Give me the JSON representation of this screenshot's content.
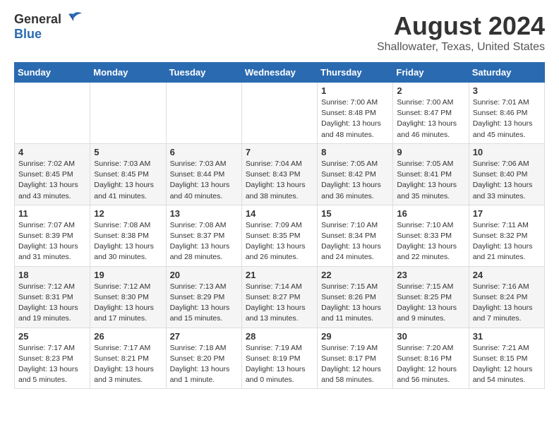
{
  "header": {
    "logo_general": "General",
    "logo_blue": "Blue",
    "title": "August 2024",
    "subtitle": "Shallowater, Texas, United States"
  },
  "calendar": {
    "days_of_week": [
      "Sunday",
      "Monday",
      "Tuesday",
      "Wednesday",
      "Thursday",
      "Friday",
      "Saturday"
    ],
    "weeks": [
      [
        {
          "day": "",
          "sunrise": "",
          "sunset": "",
          "daylight": ""
        },
        {
          "day": "",
          "sunrise": "",
          "sunset": "",
          "daylight": ""
        },
        {
          "day": "",
          "sunrise": "",
          "sunset": "",
          "daylight": ""
        },
        {
          "day": "",
          "sunrise": "",
          "sunset": "",
          "daylight": ""
        },
        {
          "day": "1",
          "sunrise": "Sunrise: 7:00 AM",
          "sunset": "Sunset: 8:48 PM",
          "daylight": "Daylight: 13 hours and 48 minutes."
        },
        {
          "day": "2",
          "sunrise": "Sunrise: 7:00 AM",
          "sunset": "Sunset: 8:47 PM",
          "daylight": "Daylight: 13 hours and 46 minutes."
        },
        {
          "day": "3",
          "sunrise": "Sunrise: 7:01 AM",
          "sunset": "Sunset: 8:46 PM",
          "daylight": "Daylight: 13 hours and 45 minutes."
        }
      ],
      [
        {
          "day": "4",
          "sunrise": "Sunrise: 7:02 AM",
          "sunset": "Sunset: 8:45 PM",
          "daylight": "Daylight: 13 hours and 43 minutes."
        },
        {
          "day": "5",
          "sunrise": "Sunrise: 7:03 AM",
          "sunset": "Sunset: 8:45 PM",
          "daylight": "Daylight: 13 hours and 41 minutes."
        },
        {
          "day": "6",
          "sunrise": "Sunrise: 7:03 AM",
          "sunset": "Sunset: 8:44 PM",
          "daylight": "Daylight: 13 hours and 40 minutes."
        },
        {
          "day": "7",
          "sunrise": "Sunrise: 7:04 AM",
          "sunset": "Sunset: 8:43 PM",
          "daylight": "Daylight: 13 hours and 38 minutes."
        },
        {
          "day": "8",
          "sunrise": "Sunrise: 7:05 AM",
          "sunset": "Sunset: 8:42 PM",
          "daylight": "Daylight: 13 hours and 36 minutes."
        },
        {
          "day": "9",
          "sunrise": "Sunrise: 7:05 AM",
          "sunset": "Sunset: 8:41 PM",
          "daylight": "Daylight: 13 hours and 35 minutes."
        },
        {
          "day": "10",
          "sunrise": "Sunrise: 7:06 AM",
          "sunset": "Sunset: 8:40 PM",
          "daylight": "Daylight: 13 hours and 33 minutes."
        }
      ],
      [
        {
          "day": "11",
          "sunrise": "Sunrise: 7:07 AM",
          "sunset": "Sunset: 8:39 PM",
          "daylight": "Daylight: 13 hours and 31 minutes."
        },
        {
          "day": "12",
          "sunrise": "Sunrise: 7:08 AM",
          "sunset": "Sunset: 8:38 PM",
          "daylight": "Daylight: 13 hours and 30 minutes."
        },
        {
          "day": "13",
          "sunrise": "Sunrise: 7:08 AM",
          "sunset": "Sunset: 8:37 PM",
          "daylight": "Daylight: 13 hours and 28 minutes."
        },
        {
          "day": "14",
          "sunrise": "Sunrise: 7:09 AM",
          "sunset": "Sunset: 8:35 PM",
          "daylight": "Daylight: 13 hours and 26 minutes."
        },
        {
          "day": "15",
          "sunrise": "Sunrise: 7:10 AM",
          "sunset": "Sunset: 8:34 PM",
          "daylight": "Daylight: 13 hours and 24 minutes."
        },
        {
          "day": "16",
          "sunrise": "Sunrise: 7:10 AM",
          "sunset": "Sunset: 8:33 PM",
          "daylight": "Daylight: 13 hours and 22 minutes."
        },
        {
          "day": "17",
          "sunrise": "Sunrise: 7:11 AM",
          "sunset": "Sunset: 8:32 PM",
          "daylight": "Daylight: 13 hours and 21 minutes."
        }
      ],
      [
        {
          "day": "18",
          "sunrise": "Sunrise: 7:12 AM",
          "sunset": "Sunset: 8:31 PM",
          "daylight": "Daylight: 13 hours and 19 minutes."
        },
        {
          "day": "19",
          "sunrise": "Sunrise: 7:12 AM",
          "sunset": "Sunset: 8:30 PM",
          "daylight": "Daylight: 13 hours and 17 minutes."
        },
        {
          "day": "20",
          "sunrise": "Sunrise: 7:13 AM",
          "sunset": "Sunset: 8:29 PM",
          "daylight": "Daylight: 13 hours and 15 minutes."
        },
        {
          "day": "21",
          "sunrise": "Sunrise: 7:14 AM",
          "sunset": "Sunset: 8:27 PM",
          "daylight": "Daylight: 13 hours and 13 minutes."
        },
        {
          "day": "22",
          "sunrise": "Sunrise: 7:15 AM",
          "sunset": "Sunset: 8:26 PM",
          "daylight": "Daylight: 13 hours and 11 minutes."
        },
        {
          "day": "23",
          "sunrise": "Sunrise: 7:15 AM",
          "sunset": "Sunset: 8:25 PM",
          "daylight": "Daylight: 13 hours and 9 minutes."
        },
        {
          "day": "24",
          "sunrise": "Sunrise: 7:16 AM",
          "sunset": "Sunset: 8:24 PM",
          "daylight": "Daylight: 13 hours and 7 minutes."
        }
      ],
      [
        {
          "day": "25",
          "sunrise": "Sunrise: 7:17 AM",
          "sunset": "Sunset: 8:23 PM",
          "daylight": "Daylight: 13 hours and 5 minutes."
        },
        {
          "day": "26",
          "sunrise": "Sunrise: 7:17 AM",
          "sunset": "Sunset: 8:21 PM",
          "daylight": "Daylight: 13 hours and 3 minutes."
        },
        {
          "day": "27",
          "sunrise": "Sunrise: 7:18 AM",
          "sunset": "Sunset: 8:20 PM",
          "daylight": "Daylight: 13 hours and 1 minute."
        },
        {
          "day": "28",
          "sunrise": "Sunrise: 7:19 AM",
          "sunset": "Sunset: 8:19 PM",
          "daylight": "Daylight: 13 hours and 0 minutes."
        },
        {
          "day": "29",
          "sunrise": "Sunrise: 7:19 AM",
          "sunset": "Sunset: 8:17 PM",
          "daylight": "Daylight: 12 hours and 58 minutes."
        },
        {
          "day": "30",
          "sunrise": "Sunrise: 7:20 AM",
          "sunset": "Sunset: 8:16 PM",
          "daylight": "Daylight: 12 hours and 56 minutes."
        },
        {
          "day": "31",
          "sunrise": "Sunrise: 7:21 AM",
          "sunset": "Sunset: 8:15 PM",
          "daylight": "Daylight: 12 hours and 54 minutes."
        }
      ]
    ]
  }
}
